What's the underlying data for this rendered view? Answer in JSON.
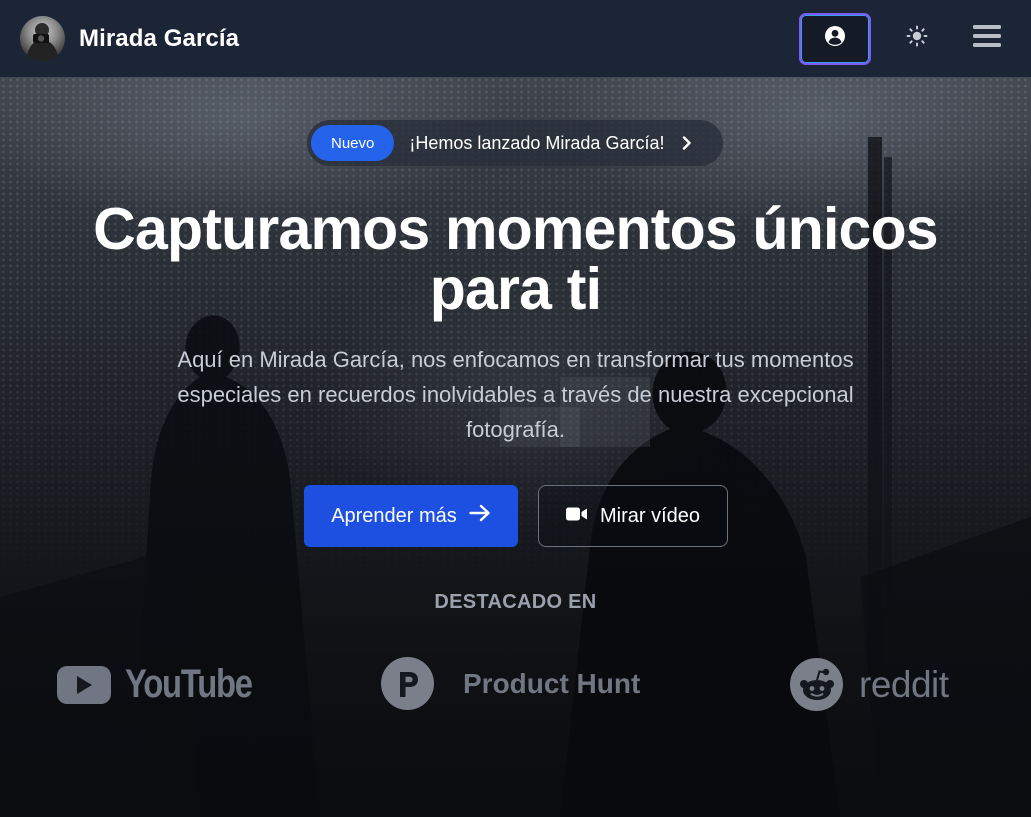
{
  "header": {
    "brand_name": "Mirada García",
    "icons": {
      "account": "user-circle-icon",
      "theme": "sun-icon",
      "menu": "hamburger-menu-icon"
    }
  },
  "hero": {
    "announcement": {
      "badge": "Nuevo",
      "text": "¡Hemos lanzado Mirada García!"
    },
    "headline_line1": "Capturamos momentos únicos",
    "headline_line2": "para ti",
    "description": "Aquí en Mirada García, nos enfocamos en transformar tus momentos especiales en recuerdos inolvidables a través de nuestra excepcional fotografía.",
    "primary_button": "Aprender más",
    "secondary_button": "Mirar vídeo"
  },
  "featured": {
    "label": "DESTACADO EN",
    "logos": [
      {
        "name": "YouTube",
        "icon": "youtube-icon"
      },
      {
        "name": "Product Hunt",
        "icon": "product-hunt-icon"
      },
      {
        "name": "reddit",
        "icon": "reddit-icon"
      }
    ]
  },
  "colors": {
    "navbar_bg": "#1c2535",
    "accent_blue": "#1d4fe0",
    "badge_blue": "#2563eb",
    "account_border": "#7c5cf0"
  }
}
